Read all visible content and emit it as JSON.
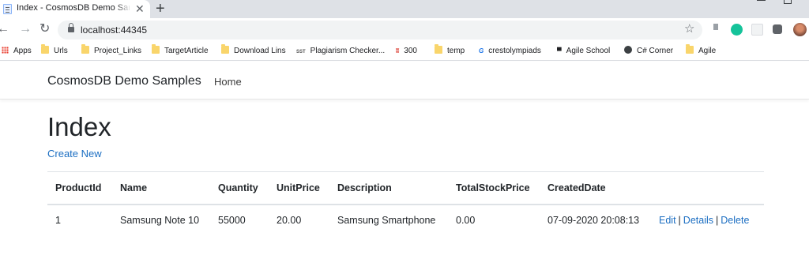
{
  "browser": {
    "tab_title": "Index - CosmosDB Demo Samples",
    "tab_close": "✕",
    "new_tab": "+",
    "url": "localhost:44345",
    "back": "←",
    "forward": "→",
    "reload": "↻",
    "bookmark_star": "☆",
    "bookmarks": [
      {
        "label": "Apps",
        "icon": "apps-grid-icon"
      },
      {
        "label": "Urls",
        "icon": "folder-icon"
      },
      {
        "label": "Project_Links",
        "icon": "folder-icon"
      },
      {
        "label": "TargetArticle",
        "icon": "folder-icon"
      },
      {
        "label": "Download Lins",
        "icon": "folder-icon"
      },
      {
        "label": "Plagiarism Checker...",
        "icon": "sst-icon"
      },
      {
        "label": "300",
        "icon": "red-logo-icon"
      },
      {
        "label": "temp",
        "icon": "folder-icon"
      },
      {
        "label": "crestolympiads",
        "icon": "crest-logo-icon"
      },
      {
        "label": "Agile School",
        "icon": "agile-logo-icon"
      },
      {
        "label": "C# Corner",
        "icon": "globe-icon"
      },
      {
        "label": "Agile",
        "icon": "folder-icon"
      }
    ],
    "bookmark_icon_text": {
      "sst": "SST",
      "red": "ʬ",
      "crest": "G",
      "agile": "▀"
    }
  },
  "site": {
    "brand": "CosmosDB Demo Samples",
    "nav_home": "Home"
  },
  "main": {
    "title": "Index",
    "create_new": "Create New",
    "columns": [
      "ProductId",
      "Name",
      "Quantity",
      "UnitPrice",
      "Description",
      "TotalStockPrice",
      "CreatedDate",
      ""
    ],
    "rows": [
      {
        "product_id": "1",
        "name": "Samsung Note 10",
        "quantity": "55000",
        "unit_price": "20.00",
        "description": "Samsung Smartphone",
        "total_stock_price": "0.00",
        "created_date": "07-09-2020 20:08:13",
        "actions": {
          "edit": "Edit",
          "details": "Details",
          "delete": "Delete",
          "separator": "|"
        }
      }
    ]
  },
  "colors": {
    "link": "#1b6ec2",
    "tabstrip": "#dee1e6",
    "text": "#212529"
  }
}
